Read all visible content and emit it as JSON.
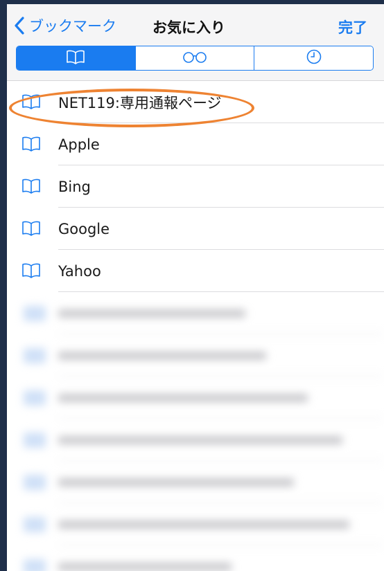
{
  "nav": {
    "back_label": "ブックマーク",
    "title": "お気に入り",
    "done_label": "完了"
  },
  "segments": [
    {
      "icon": "book-icon",
      "active": true
    },
    {
      "icon": "glasses-icon",
      "active": false
    },
    {
      "icon": "clock-icon",
      "active": false
    }
  ],
  "favorites": [
    {
      "label": "NET119:専用通報ページ"
    },
    {
      "label": "Apple"
    },
    {
      "label": "Bing"
    },
    {
      "label": "Google"
    },
    {
      "label": "Yahoo"
    }
  ],
  "colors": {
    "accent": "#1a7cf0",
    "highlight": "#ee8332",
    "nav_bg": "#f5f5f6"
  }
}
